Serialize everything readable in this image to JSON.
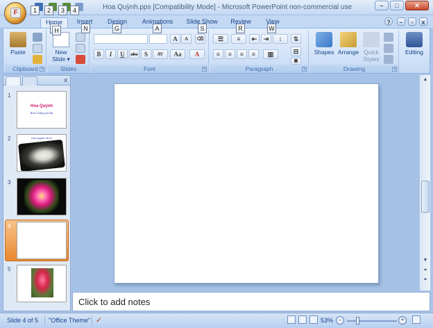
{
  "window": {
    "title": "Hoa Quỳnh.pps [Compatibility Mode] - Microsoft PowerPoint non-commercial use",
    "minimize": "–",
    "maximize": "□",
    "close": "✕"
  },
  "office_button": {
    "label": "F"
  },
  "qat_keytips": [
    "1",
    "2",
    "3",
    "4"
  ],
  "ribbon_tabs": [
    {
      "label": "Home",
      "keytip": "H"
    },
    {
      "label": "Insert",
      "keytip": "N"
    },
    {
      "label": "Design",
      "keytip": "G"
    },
    {
      "label": "Animations",
      "keytip": "A"
    },
    {
      "label": "Slide Show",
      "keytip": "S"
    },
    {
      "label": "Review",
      "keytip": "R"
    },
    {
      "label": "View",
      "keytip": "W"
    }
  ],
  "groups": {
    "clipboard": {
      "label": "Clipboard",
      "paste": "Paste"
    },
    "slides": {
      "label": "Slides",
      "new_slide": "New Slide ▾"
    },
    "font": {
      "label": "Font",
      "bold": "B",
      "italic": "I",
      "underline": "U",
      "strike": "abc",
      "shadow": "S",
      "spacing": "AV",
      "case": "Aa",
      "color": "A",
      "grow": "A",
      "shrink": "A"
    },
    "paragraph": {
      "label": "Paragraph"
    },
    "drawing": {
      "label": "Drawing",
      "shapes": "Shapes",
      "arrange": "Arrange",
      "quick_styles": "Quick Styles"
    },
    "editing": {
      "label": "Editing"
    }
  },
  "slides_panel": {
    "close": "x",
    "slides": [
      {
        "number": "1",
        "title": "Hoa Quỳnh",
        "subtitle": "Bừa Tuổng và Dật"
      },
      {
        "number": "2",
        "caption": "Hoa quỳnh nở rộ"
      },
      {
        "number": "3"
      },
      {
        "number": "4"
      },
      {
        "number": "5"
      }
    ]
  },
  "notes": {
    "placeholder": "Click to add notes"
  },
  "status": {
    "slide_info": "Slide 4 of 5",
    "theme": "\"Office Theme\"",
    "zoom": "53%"
  },
  "colors": {
    "accent": "#15428b",
    "selected_thumb": "#e9892f",
    "ribbon_bg": "#d3e3f8"
  }
}
